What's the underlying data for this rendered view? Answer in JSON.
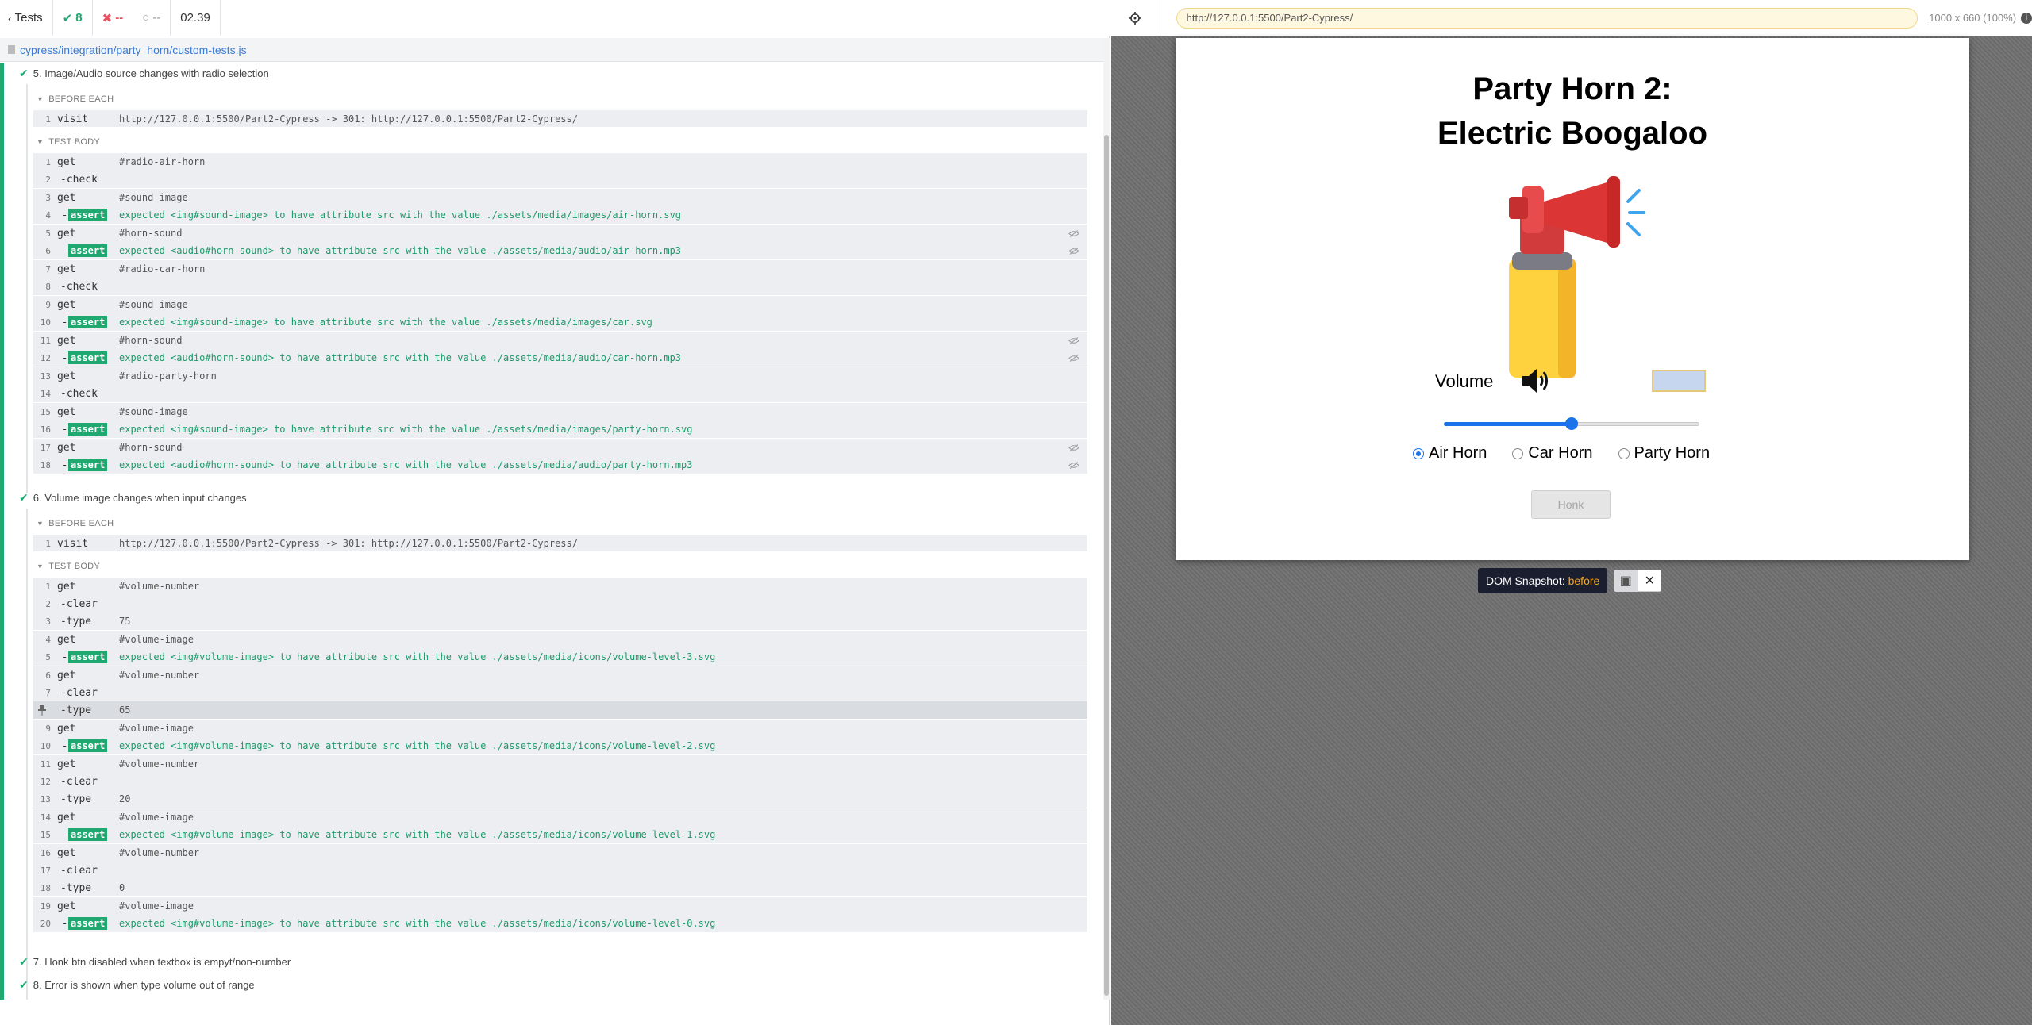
{
  "topbar": {
    "back_label": "Tests",
    "passed": "8",
    "failed": "--",
    "pending": "--",
    "duration": "02.39"
  },
  "spec_path": "cypress/integration/party_horn/custom-tests.js",
  "test5": {
    "title": "5. Image/Audio source changes with radio selection",
    "before_each_label": "BEFORE EACH",
    "test_body_label": "TEST BODY",
    "visit": {
      "num": "1",
      "name": "visit",
      "msg": "http://127.0.0.1:5500/Part2-Cypress -> 301: http://127.0.0.1:5500/Part2-Cypress/"
    },
    "commands": [
      {
        "num": "1",
        "name": "get",
        "msg": "#radio-air-horn"
      },
      {
        "num": "2",
        "name": "-check",
        "msg": ""
      },
      {
        "num": "3",
        "name": "get",
        "msg": "#sound-image"
      },
      {
        "num": "4",
        "name": "assert",
        "msg": "expected <img#sound-image> to have attribute src with the value ./assets/media/images/air-horn.svg"
      },
      {
        "num": "5",
        "name": "get",
        "msg": "#horn-sound"
      },
      {
        "num": "6",
        "name": "assert",
        "msg": "expected <audio#horn-sound> to have attribute src with the value ./assets/media/audio/air-horn.mp3"
      },
      {
        "num": "7",
        "name": "get",
        "msg": "#radio-car-horn"
      },
      {
        "num": "8",
        "name": "-check",
        "msg": ""
      },
      {
        "num": "9",
        "name": "get",
        "msg": "#sound-image"
      },
      {
        "num": "10",
        "name": "assert",
        "msg": "expected <img#sound-image> to have attribute src with the value ./assets/media/images/car.svg"
      },
      {
        "num": "11",
        "name": "get",
        "msg": "#horn-sound"
      },
      {
        "num": "12",
        "name": "assert",
        "msg": "expected <audio#horn-sound> to have attribute src with the value ./assets/media/audio/car-horn.mp3"
      },
      {
        "num": "13",
        "name": "get",
        "msg": "#radio-party-horn"
      },
      {
        "num": "14",
        "name": "-check",
        "msg": ""
      },
      {
        "num": "15",
        "name": "get",
        "msg": "#sound-image"
      },
      {
        "num": "16",
        "name": "assert",
        "msg": "expected <img#sound-image> to have attribute src with the value ./assets/media/images/party-horn.svg"
      },
      {
        "num": "17",
        "name": "get",
        "msg": "#horn-sound"
      },
      {
        "num": "18",
        "name": "assert",
        "msg": "expected <audio#horn-sound> to have attribute src with the value ./assets/media/audio/party-horn.mp3"
      }
    ]
  },
  "test6": {
    "title": "6. Volume image changes when input changes",
    "before_each_label": "BEFORE EACH",
    "test_body_label": "TEST BODY",
    "visit": {
      "num": "1",
      "name": "visit",
      "msg": "http://127.0.0.1:5500/Part2-Cypress -> 301: http://127.0.0.1:5500/Part2-Cypress/"
    },
    "commands": [
      {
        "num": "1",
        "name": "get",
        "msg": "#volume-number"
      },
      {
        "num": "2",
        "name": "-clear",
        "msg": ""
      },
      {
        "num": "3",
        "name": "-type",
        "msg": "75"
      },
      {
        "num": "4",
        "name": "get",
        "msg": "#volume-image"
      },
      {
        "num": "5",
        "name": "assert",
        "msg": "expected <img#volume-image> to have attribute src with the value ./assets/media/icons/volume-level-3.svg"
      },
      {
        "num": "6",
        "name": "get",
        "msg": "#volume-number"
      },
      {
        "num": "7",
        "name": "-clear",
        "msg": ""
      },
      {
        "num": "8",
        "name": "-type",
        "msg": "65"
      },
      {
        "num": "9",
        "name": "get",
        "msg": "#volume-image"
      },
      {
        "num": "10",
        "name": "assert",
        "msg": "expected <img#volume-image> to have attribute src with the value ./assets/media/icons/volume-level-2.svg"
      },
      {
        "num": "11",
        "name": "get",
        "msg": "#volume-number"
      },
      {
        "num": "12",
        "name": "-clear",
        "msg": ""
      },
      {
        "num": "13",
        "name": "-type",
        "msg": "20"
      },
      {
        "num": "14",
        "name": "get",
        "msg": "#volume-image"
      },
      {
        "num": "15",
        "name": "assert",
        "msg": "expected <img#volume-image> to have attribute src with the value ./assets/media/icons/volume-level-1.svg"
      },
      {
        "num": "16",
        "name": "get",
        "msg": "#volume-number"
      },
      {
        "num": "17",
        "name": "-clear",
        "msg": ""
      },
      {
        "num": "18",
        "name": "-type",
        "msg": "0"
      },
      {
        "num": "19",
        "name": "get",
        "msg": "#volume-image"
      },
      {
        "num": "20",
        "name": "assert",
        "msg": "expected <img#volume-image> to have attribute src with the value ./assets/media/icons/volume-level-0.svg"
      }
    ]
  },
  "other_tests": [
    "7. Honk btn disabled when textbox is empyt/non-number",
    "8. Error is shown when type volume out of range"
  ],
  "browser": {
    "url": "http://127.0.0.1:5500/Part2-Cypress/",
    "viewport": "1000 x 660",
    "zoom": "(100%)"
  },
  "app": {
    "title_line1": "Party Horn 2:",
    "title_line2": "Electric Boogaloo",
    "volume_label": "Volume",
    "volume_value": "",
    "volume_level": 0.5,
    "radios": [
      {
        "label": "Air Horn",
        "checked": true
      },
      {
        "label": "Car Horn",
        "checked": false
      },
      {
        "label": "Party Horn",
        "checked": false
      }
    ],
    "honk_label": "Honk"
  },
  "snapshot": {
    "label": "DOM Snapshot:",
    "state": "before"
  },
  "colors": {
    "pass": "#1fa971",
    "fail": "#e94f5f",
    "accent": "#1a73e8"
  }
}
